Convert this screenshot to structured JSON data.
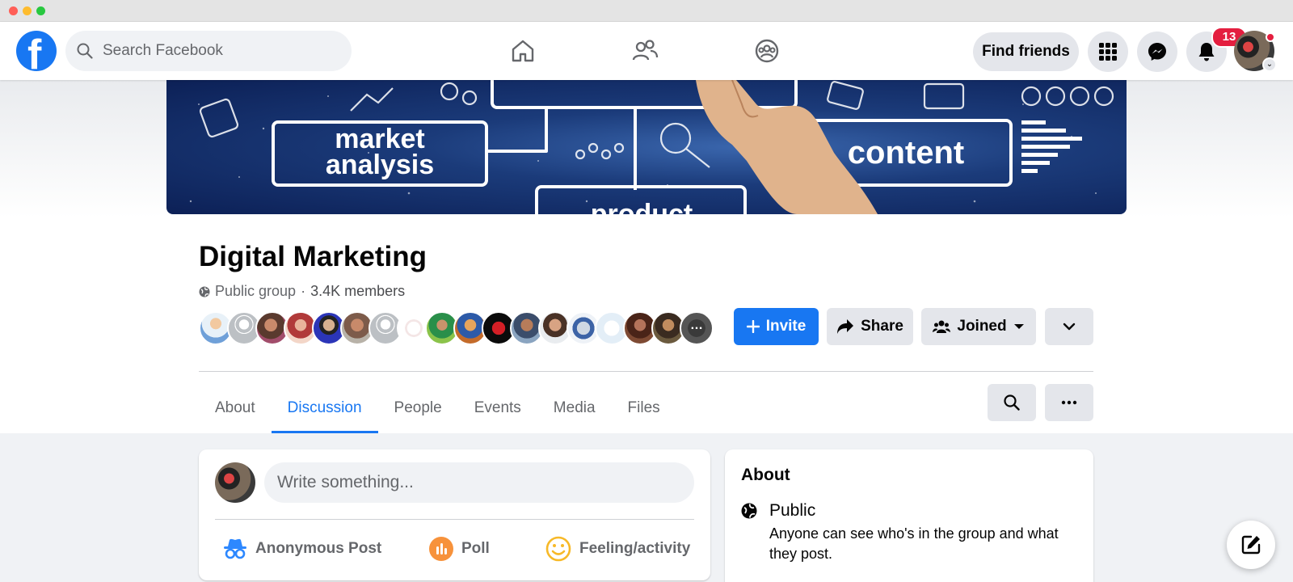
{
  "window": {
    "traffic_lights": [
      "#ff5f57",
      "#febc2e",
      "#28c840"
    ]
  },
  "topbar": {
    "search_placeholder": "Search Facebook",
    "find_friends_label": "Find friends",
    "notification_count": "13",
    "nav_icons": [
      "home-icon",
      "friends-icon",
      "groups-icon"
    ],
    "right_icons": [
      "menu-grid-icon",
      "messenger-icon",
      "bell-icon"
    ]
  },
  "cover": {
    "words": [
      "market",
      "analysis",
      "content",
      "product"
    ]
  },
  "group": {
    "name": "Digital Marketing",
    "privacy": "Public group",
    "separator": "·",
    "members": "3.4K members",
    "member_avatar_count": 18
  },
  "actions": {
    "invite": "Invite",
    "share": "Share",
    "joined": "Joined"
  },
  "tabs": [
    {
      "label": "About",
      "active": false
    },
    {
      "label": "Discussion",
      "active": true
    },
    {
      "label": "People",
      "active": false
    },
    {
      "label": "Events",
      "active": false
    },
    {
      "label": "Media",
      "active": false
    },
    {
      "label": "Files",
      "active": false
    }
  ],
  "composer": {
    "placeholder": "Write something...",
    "actions": [
      {
        "label": "Anonymous Post",
        "icon": "incognito-icon"
      },
      {
        "label": "Poll",
        "icon": "poll-icon"
      },
      {
        "label": "Feeling/activity",
        "icon": "smiley-icon"
      }
    ]
  },
  "about_card": {
    "title": "About",
    "privacy_title": "Public",
    "privacy_desc": "Anyone can see who's in the group and what they post."
  },
  "colors": {
    "accent": "#1877f2",
    "badge": "#e41e3f",
    "poll": "#f7923b",
    "feeling": "#f7b928",
    "incognito": "#2d88ff"
  }
}
